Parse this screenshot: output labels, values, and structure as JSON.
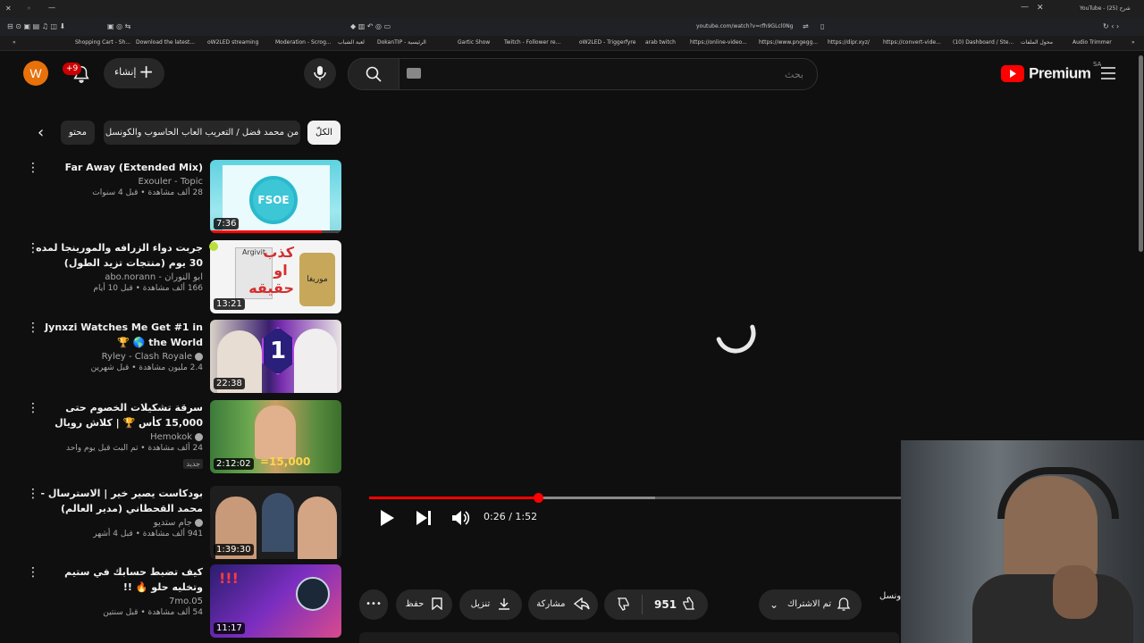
{
  "browser": {
    "url": "youtube.com/watch?v=rfh9GLcl0Ng",
    "tab_title": "YouTube - شرح (25)",
    "bookmarks": [
      "Shopping Cart - Sh...",
      "Download the latest...",
      "oW2LED streaming",
      "Moderation - Scrog...",
      "لعبة الشباب",
      "DokanTIP - الرئيسية",
      "Gartic Show",
      "Twitch - Follower re...",
      "oW2LED - Triggerfyre",
      "arab twitch",
      "https://online-video...",
      "https://www.pngegg...",
      "https://dipr.xyz/",
      "https://convert-vide...",
      "(10) Dashboard / Ste...",
      "محول الملفات",
      "Audio Trimmer"
    ]
  },
  "header": {
    "avatar_letter": "W",
    "notifications_badge": "+9",
    "create_label": "إنشاء",
    "search_placeholder": "بحث",
    "logo_text": "Premium",
    "region": "SA"
  },
  "chips": [
    "الكلّ",
    "من محمد فضل / التعريب العاب الحاسوب والكونسل",
    "محتو"
  ],
  "videos": [
    {
      "title": "Far Away (Extended Mix)",
      "channel": "Exouler - Topic",
      "stats": "28 ألف مشاهدة • قبل 4 سنوات",
      "duration": "7:36",
      "verified": false,
      "watched": 0.85
    },
    {
      "title": "جربت دواء الزرافه والمورينجا لمده 30 يوم (منتجات تزيد الطول)",
      "channel": "ابو النوران - abo.norann",
      "stats": "166 ألف مشاهدة • قبل 10 أيام",
      "duration": "13:21",
      "verified": false,
      "watched": 0
    },
    {
      "title": "Jynxzi Watches Me Get #1 in the World 🌎 🏆",
      "channel": "Ryley - Clash Royale",
      "stats": "2.4 مليون مشاهدة • قبل شهرين",
      "duration": "22:38",
      "verified": true,
      "watched": 0
    },
    {
      "title": "سرقة تشكيلات الخصوم حتى 15,000 كأس 🏆 | كلاش رويال",
      "channel": "Hemokok",
      "stats": "24 ألف مشاهدة • تم البث قبل يوم واحد",
      "badge": "جديد",
      "duration": "2:12:02",
      "verified": true,
      "watched": 0
    },
    {
      "title": "بودكاست يصير خير | الاسترسال - محمد القحطاني (مدير العالم)",
      "channel": "جام ستديو",
      "stats": "941 ألف مشاهدة • قبل 4 أشهر",
      "duration": "1:39:30",
      "verified": true,
      "watched": 0
    },
    {
      "title": "كيف تضبط حسابك في ستيم وتخليه حلو 🔥 !!",
      "channel": "7mo.05",
      "stats": "54 ألف مشاهدة • قبل سنتين",
      "duration": "11:17",
      "verified": false,
      "watched": 0
    }
  ],
  "thumb_text": {
    "v2_big": "كذب او حقيقه",
    "v2_jar": "موريغا",
    "v2_box": "Argivit",
    "v4_counter": "=15,000",
    "v1_logo": "FSOE"
  },
  "player": {
    "current_time": "0:26",
    "total_time": "1:52",
    "time_display": "0:26 / 1:52",
    "played_fraction": 0.23
  },
  "actions": {
    "subscribed_label": "تم الاشتراك",
    "like_count": "951",
    "share_label": "مشاركة",
    "download_label": "تنزيل",
    "save_label": "حفظ",
    "channel_partial": "ونسل"
  },
  "colors": {
    "accent": "#ff0000",
    "bg": "#0f0f0f",
    "chip": "#272727",
    "avatar": "#e8710a"
  }
}
